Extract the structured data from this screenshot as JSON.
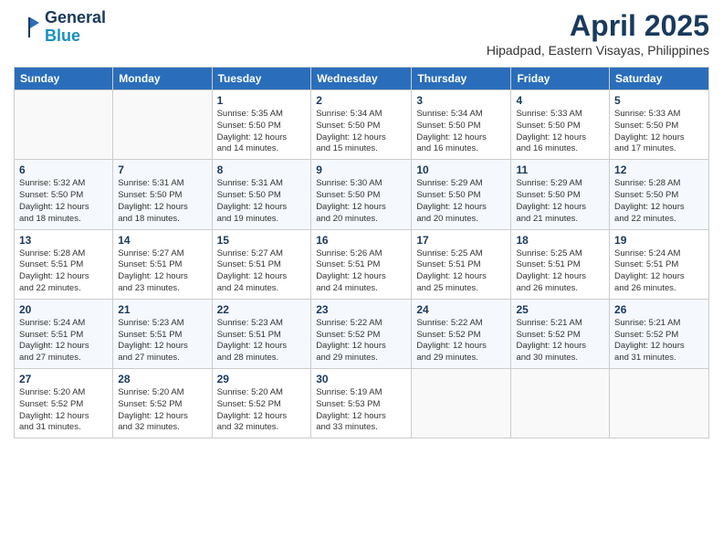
{
  "header": {
    "logo_line1": "General",
    "logo_line2": "Blue",
    "title": "April 2025",
    "subtitle": "Hipadpad, Eastern Visayas, Philippines"
  },
  "calendar": {
    "weekdays": [
      "Sunday",
      "Monday",
      "Tuesday",
      "Wednesday",
      "Thursday",
      "Friday",
      "Saturday"
    ],
    "weeks": [
      [
        {
          "day": "",
          "info": ""
        },
        {
          "day": "",
          "info": ""
        },
        {
          "day": "1",
          "info": "Sunrise: 5:35 AM\nSunset: 5:50 PM\nDaylight: 12 hours\nand 14 minutes."
        },
        {
          "day": "2",
          "info": "Sunrise: 5:34 AM\nSunset: 5:50 PM\nDaylight: 12 hours\nand 15 minutes."
        },
        {
          "day": "3",
          "info": "Sunrise: 5:34 AM\nSunset: 5:50 PM\nDaylight: 12 hours\nand 16 minutes."
        },
        {
          "day": "4",
          "info": "Sunrise: 5:33 AM\nSunset: 5:50 PM\nDaylight: 12 hours\nand 16 minutes."
        },
        {
          "day": "5",
          "info": "Sunrise: 5:33 AM\nSunset: 5:50 PM\nDaylight: 12 hours\nand 17 minutes."
        }
      ],
      [
        {
          "day": "6",
          "info": "Sunrise: 5:32 AM\nSunset: 5:50 PM\nDaylight: 12 hours\nand 18 minutes."
        },
        {
          "day": "7",
          "info": "Sunrise: 5:31 AM\nSunset: 5:50 PM\nDaylight: 12 hours\nand 18 minutes."
        },
        {
          "day": "8",
          "info": "Sunrise: 5:31 AM\nSunset: 5:50 PM\nDaylight: 12 hours\nand 19 minutes."
        },
        {
          "day": "9",
          "info": "Sunrise: 5:30 AM\nSunset: 5:50 PM\nDaylight: 12 hours\nand 20 minutes."
        },
        {
          "day": "10",
          "info": "Sunrise: 5:29 AM\nSunset: 5:50 PM\nDaylight: 12 hours\nand 20 minutes."
        },
        {
          "day": "11",
          "info": "Sunrise: 5:29 AM\nSunset: 5:50 PM\nDaylight: 12 hours\nand 21 minutes."
        },
        {
          "day": "12",
          "info": "Sunrise: 5:28 AM\nSunset: 5:50 PM\nDaylight: 12 hours\nand 22 minutes."
        }
      ],
      [
        {
          "day": "13",
          "info": "Sunrise: 5:28 AM\nSunset: 5:51 PM\nDaylight: 12 hours\nand 22 minutes."
        },
        {
          "day": "14",
          "info": "Sunrise: 5:27 AM\nSunset: 5:51 PM\nDaylight: 12 hours\nand 23 minutes."
        },
        {
          "day": "15",
          "info": "Sunrise: 5:27 AM\nSunset: 5:51 PM\nDaylight: 12 hours\nand 24 minutes."
        },
        {
          "day": "16",
          "info": "Sunrise: 5:26 AM\nSunset: 5:51 PM\nDaylight: 12 hours\nand 24 minutes."
        },
        {
          "day": "17",
          "info": "Sunrise: 5:25 AM\nSunset: 5:51 PM\nDaylight: 12 hours\nand 25 minutes."
        },
        {
          "day": "18",
          "info": "Sunrise: 5:25 AM\nSunset: 5:51 PM\nDaylight: 12 hours\nand 26 minutes."
        },
        {
          "day": "19",
          "info": "Sunrise: 5:24 AM\nSunset: 5:51 PM\nDaylight: 12 hours\nand 26 minutes."
        }
      ],
      [
        {
          "day": "20",
          "info": "Sunrise: 5:24 AM\nSunset: 5:51 PM\nDaylight: 12 hours\nand 27 minutes."
        },
        {
          "day": "21",
          "info": "Sunrise: 5:23 AM\nSunset: 5:51 PM\nDaylight: 12 hours\nand 27 minutes."
        },
        {
          "day": "22",
          "info": "Sunrise: 5:23 AM\nSunset: 5:51 PM\nDaylight: 12 hours\nand 28 minutes."
        },
        {
          "day": "23",
          "info": "Sunrise: 5:22 AM\nSunset: 5:52 PM\nDaylight: 12 hours\nand 29 minutes."
        },
        {
          "day": "24",
          "info": "Sunrise: 5:22 AM\nSunset: 5:52 PM\nDaylight: 12 hours\nand 29 minutes."
        },
        {
          "day": "25",
          "info": "Sunrise: 5:21 AM\nSunset: 5:52 PM\nDaylight: 12 hours\nand 30 minutes."
        },
        {
          "day": "26",
          "info": "Sunrise: 5:21 AM\nSunset: 5:52 PM\nDaylight: 12 hours\nand 31 minutes."
        }
      ],
      [
        {
          "day": "27",
          "info": "Sunrise: 5:20 AM\nSunset: 5:52 PM\nDaylight: 12 hours\nand 31 minutes."
        },
        {
          "day": "28",
          "info": "Sunrise: 5:20 AM\nSunset: 5:52 PM\nDaylight: 12 hours\nand 32 minutes."
        },
        {
          "day": "29",
          "info": "Sunrise: 5:20 AM\nSunset: 5:52 PM\nDaylight: 12 hours\nand 32 minutes."
        },
        {
          "day": "30",
          "info": "Sunrise: 5:19 AM\nSunset: 5:53 PM\nDaylight: 12 hours\nand 33 minutes."
        },
        {
          "day": "",
          "info": ""
        },
        {
          "day": "",
          "info": ""
        },
        {
          "day": "",
          "info": ""
        }
      ]
    ]
  }
}
